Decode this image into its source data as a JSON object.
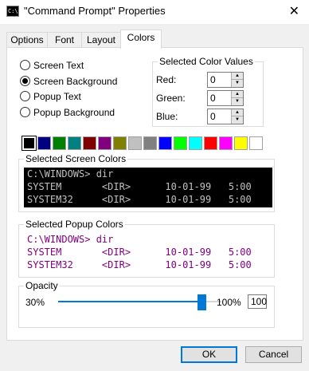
{
  "window": {
    "title": "\"Command Prompt\" Properties",
    "close_glyph": "✕",
    "icon_text": "C:\\."
  },
  "tabs": [
    {
      "label": "Options",
      "active": false
    },
    {
      "label": "Font",
      "active": false
    },
    {
      "label": "Layout",
      "active": false
    },
    {
      "label": "Colors",
      "active": true
    }
  ],
  "radios": [
    {
      "label": "Screen Text",
      "checked": false
    },
    {
      "label": "Screen Background",
      "checked": true
    },
    {
      "label": "Popup Text",
      "checked": false
    },
    {
      "label": "Popup Background",
      "checked": false
    }
  ],
  "selected_values": {
    "title": "Selected Color Values",
    "red_label": "Red:",
    "red_value": "0",
    "green_label": "Green:",
    "green_value": "0",
    "blue_label": "Blue:",
    "blue_value": "0"
  },
  "palette": [
    "#000000",
    "#000080",
    "#008000",
    "#008080",
    "#800000",
    "#800080",
    "#808000",
    "#c0c0c0",
    "#808080",
    "#0000ff",
    "#00ff00",
    "#00ffff",
    "#ff0000",
    "#ff00ff",
    "#ffff00",
    "#ffffff"
  ],
  "palette_selected_index": 0,
  "screen_preview": {
    "title": "Selected Screen Colors",
    "background": "#000000",
    "text_color": "#c0c0c0",
    "lines": [
      "C:\\WINDOWS> dir",
      "SYSTEM       <DIR>      10-01-99   5:00",
      "SYSTEM32     <DIR>      10-01-99   5:00"
    ]
  },
  "popup_preview": {
    "title": "Selected Popup Colors",
    "background": "#ffffff",
    "text_color": "#800080",
    "lines": [
      "C:\\WINDOWS> dir",
      "SYSTEM       <DIR>      10-01-99   5:00",
      "SYSTEM32     <DIR>      10-01-99   5:00"
    ]
  },
  "opacity": {
    "title": "Opacity",
    "min_label": "30%",
    "max_label": "100%",
    "value": "100",
    "fraction": 0.88
  },
  "buttons": {
    "ok": "OK",
    "cancel": "Cancel"
  }
}
